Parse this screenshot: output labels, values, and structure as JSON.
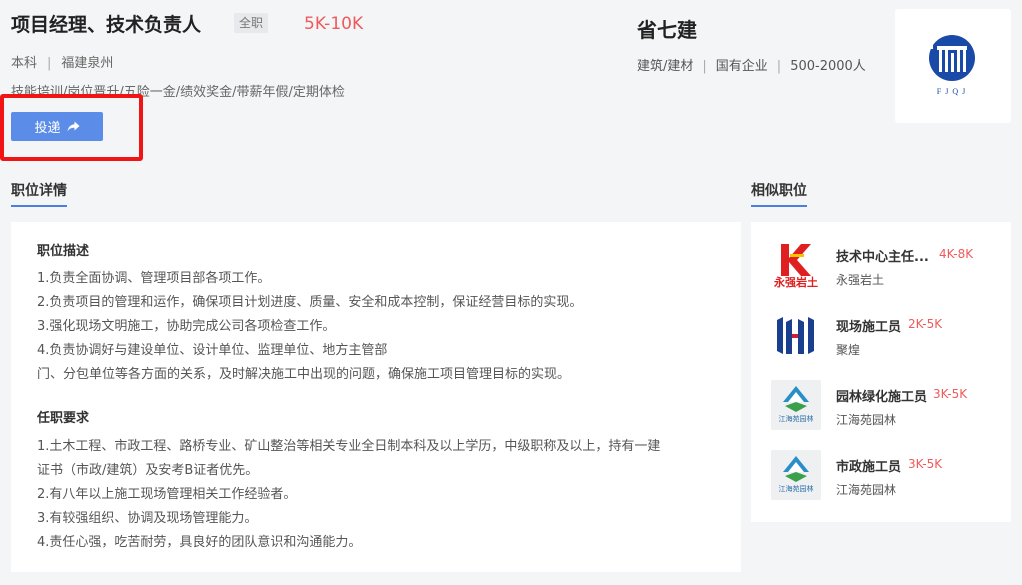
{
  "job": {
    "title": "项目经理、技术负责人",
    "type": "全职",
    "salary": "5K-10K",
    "education": "本科",
    "location": "福建泉州",
    "benefits": "技能培训/岗位晋升/五险一金/绩效奖金/带薪年假/定期体检",
    "apply_label": "投递"
  },
  "company": {
    "name": "省七建",
    "industry": "建筑/建材",
    "ownership": "国有企业",
    "size": "500-2000人",
    "logo_text": "FJQJ",
    "logo_color": "#1a4aa8"
  },
  "sections": {
    "detail_title": "职位详情",
    "similar_title": "相似职位"
  },
  "detail": {
    "desc_heading": "职位描述",
    "desc_lines": [
      "1.负责全面协调、管理项目部各项工作。",
      "2.负责项目的管理和运作，确保项目计划进度、质量、安全和成本控制，保证经营目标的实现。",
      "3.强化现场文明施工，协助完成公司各项检查工作。",
      "4.负责协调好与建设单位、设计单位、监理单位、地方主管部",
      "门、分包单位等各方面的关系，及时解决施工中出现的问题，确保施工项目管理目标的实现。"
    ],
    "req_heading": "任职要求",
    "req_lines": [
      "1.土木工程、市政工程、路桥专业、矿山整治等相关专业全日制本科及以上学历，中级职称及以上，持有一建",
      "证书（市政/建筑）及安考B证者优先。",
      "2.有八年以上施工现场管理相关工作经验者。",
      "3.有较强组织、协调及现场管理能力。",
      "4.责任心强，吃苦耐劳，具良好的团队意识和沟通能力。"
    ]
  },
  "similar": [
    {
      "title": "技术中心主任...",
      "salary": "4K-8K",
      "company": "永强岩土",
      "logo_text": "永强岩土",
      "logo_mark": "K",
      "logo_color": "#e02020"
    },
    {
      "title": "现场施工员",
      "salary": "2K-5K",
      "company": "聚煌",
      "logo_color": "#1a3f8f",
      "accent_color": "#d02030"
    },
    {
      "title": "园林绿化施工员",
      "salary": "3K-5K",
      "company": "江海苑园林",
      "logo_text": "江海苑园林",
      "logo_color": "#2a8fc8"
    },
    {
      "title": "市政施工员",
      "salary": "3K-5K",
      "company": "江海苑园林",
      "logo_text": "江海苑园林",
      "logo_color": "#2a8fc8"
    }
  ],
  "colors": {
    "accent": "#5b8de8",
    "salary": "#ef5a5a",
    "highlight": "#f01414"
  }
}
